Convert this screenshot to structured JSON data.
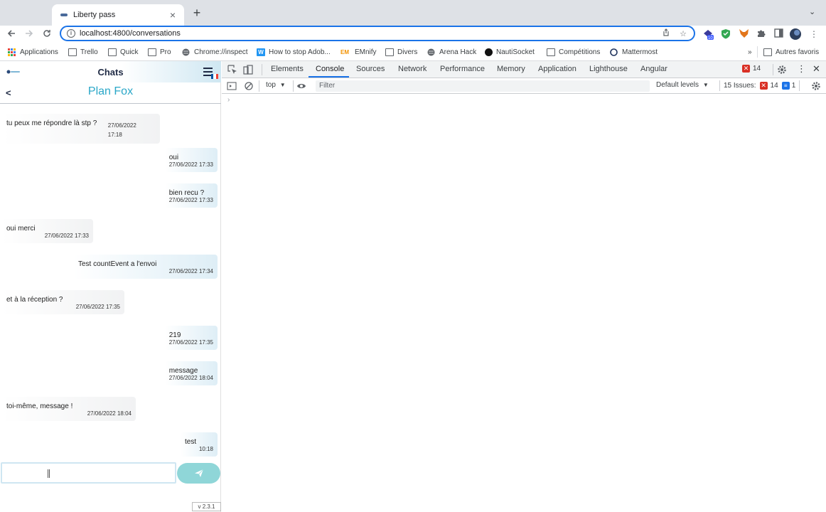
{
  "browser": {
    "tab_title": "Liberty pass",
    "tab_close": "×",
    "new_tab": "+",
    "tab_menu": "⌄",
    "url": "localhost:4800/conversations",
    "bookmarks": [
      {
        "label": "Applications",
        "icon": "apps-grid-icon"
      },
      {
        "label": "Trello",
        "icon": "folder-icon"
      },
      {
        "label": "Quick",
        "icon": "folder-icon"
      },
      {
        "label": "Pro",
        "icon": "folder-icon"
      },
      {
        "label": "Chrome://inspect",
        "icon": "globe-icon"
      },
      {
        "label": "How to stop Adob...",
        "icon": "w-logo-icon"
      },
      {
        "label": "EMnify",
        "icon": "em-logo-icon"
      },
      {
        "label": "Divers",
        "icon": "folder-icon"
      },
      {
        "label": "Arena Hack",
        "icon": "globe-icon"
      },
      {
        "label": "NautiSocket",
        "icon": "nauti-logo-icon"
      },
      {
        "label": "Compétitions",
        "icon": "folder-icon"
      },
      {
        "label": "Mattermost",
        "icon": "mattermost-icon"
      }
    ],
    "bookmarks_overflow": "»",
    "other_bookmarks": "Autres favoris",
    "extension_badge": "10"
  },
  "app": {
    "header_title": "Chats",
    "conversation_title": "Plan Fox",
    "back_label": "<",
    "input_value": "",
    "version": "v 2.3.1",
    "messages": [
      {
        "direction": "in",
        "text": "tu peux me répondre là stp ?",
        "time": "27/06/2022 17:18"
      },
      {
        "direction": "out",
        "text": "oui",
        "time": "27/06/2022 17:33"
      },
      {
        "direction": "out",
        "text": "bien recu ?",
        "time": "27/06/2022 17:33"
      },
      {
        "direction": "in",
        "text": "oui merci",
        "time": "27/06/2022 17:33"
      },
      {
        "direction": "out",
        "text": "Test countEvent a l'envoi",
        "time": "27/06/2022 17:34"
      },
      {
        "direction": "in",
        "text": "et à la réception ?",
        "time": "27/06/2022 17:35"
      },
      {
        "direction": "out",
        "text": "219",
        "time": "27/06/2022 17:35"
      },
      {
        "direction": "out",
        "text": "message",
        "time": "27/06/2022 18:04"
      },
      {
        "direction": "in",
        "text": "toi-même, message !",
        "time": "27/06/2022 18:04"
      },
      {
        "direction": "out",
        "text": "test",
        "time": "10:18"
      }
    ]
  },
  "devtools": {
    "tabs": [
      "Elements",
      "Console",
      "Sources",
      "Network",
      "Performance",
      "Memory",
      "Application",
      "Lighthouse",
      "Angular"
    ],
    "active_tab": "Console",
    "error_count": "14",
    "context": "top",
    "filter_placeholder": "Filter",
    "levels": "Default levels",
    "issues_label": "15 Issues:",
    "issues_errors": "14",
    "issues_info": "1",
    "prompt": "›"
  },
  "colors": {
    "accent": "#1a73e8",
    "app_title": "#2aa7c8",
    "send_button": "#8fd6d8",
    "error_red": "#d93025"
  }
}
